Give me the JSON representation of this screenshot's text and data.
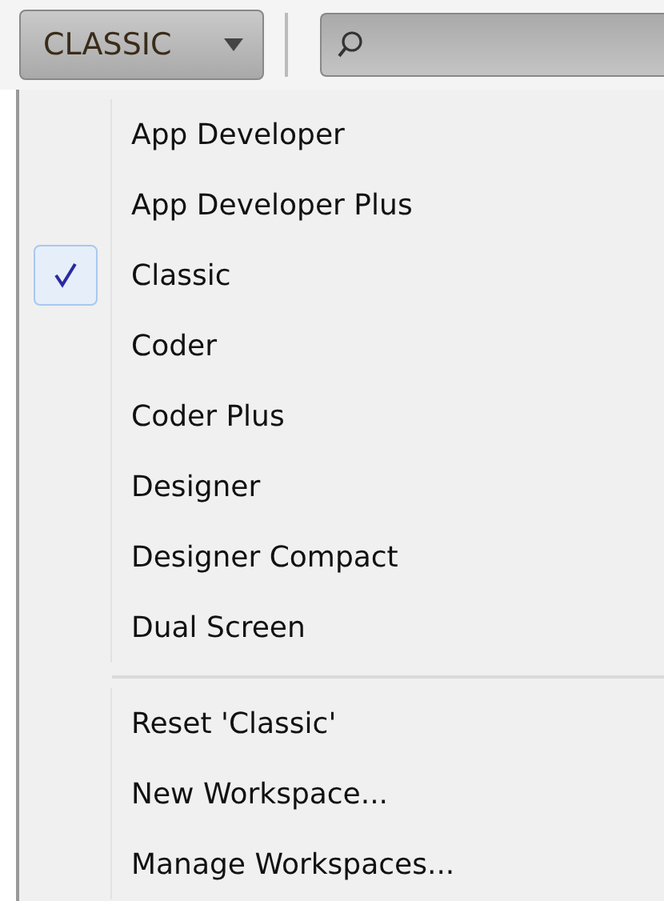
{
  "toolbar": {
    "workspace_button": {
      "label": "CLASSIC"
    }
  },
  "menu": {
    "workspaces": [
      {
        "label": "App Developer",
        "checked": false
      },
      {
        "label": "App Developer Plus",
        "checked": false
      },
      {
        "label": "Classic",
        "checked": true
      },
      {
        "label": "Coder",
        "checked": false
      },
      {
        "label": "Coder Plus",
        "checked": false
      },
      {
        "label": "Designer",
        "checked": false
      },
      {
        "label": "Designer Compact",
        "checked": false
      },
      {
        "label": "Dual Screen",
        "checked": false
      }
    ],
    "commands": [
      {
        "label": "Reset 'Classic'"
      },
      {
        "label": "New Workspace..."
      },
      {
        "label": "Manage Workspaces..."
      }
    ]
  }
}
